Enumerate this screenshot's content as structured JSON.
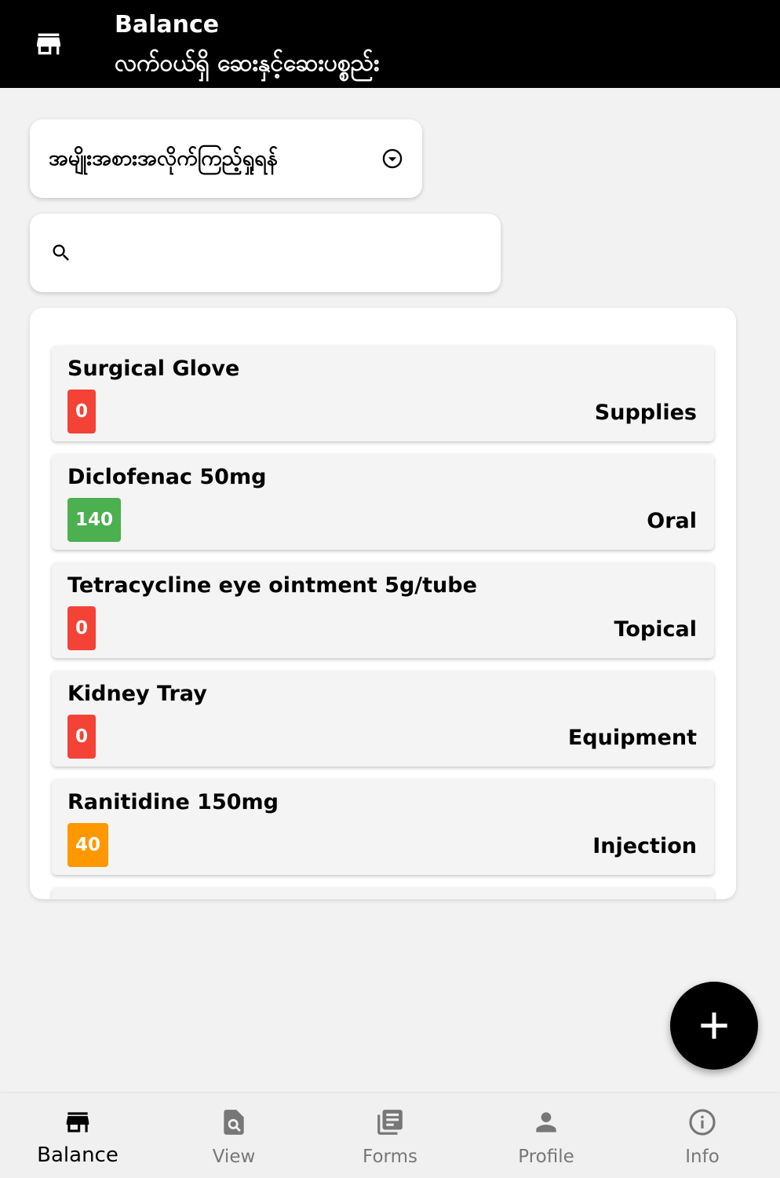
{
  "header": {
    "title": "Balance",
    "subtitle": "လက်ဝယ်ရှိ ဆေးနှင့်ဆေးပစ္စည်း",
    "icon": "store-icon"
  },
  "filter": {
    "label": "အမျိုးအစားအလိုက်ကြည့်ရှုရန်",
    "icon": "chevron-down-circle-icon"
  },
  "search": {
    "value": "",
    "placeholder": "",
    "icon": "search-icon"
  },
  "items": [
    {
      "name": "Surgical Glove",
      "quantity": "0",
      "category": "Supplies",
      "badge_color": "#f44336"
    },
    {
      "name": "Diclofenac 50mg",
      "quantity": "140",
      "category": "Oral",
      "badge_color": "#4caf50"
    },
    {
      "name": "Tetracycline eye ointment 5g/tube",
      "quantity": "0",
      "category": "Topical",
      "badge_color": "#f44336"
    },
    {
      "name": "Kidney Tray",
      "quantity": "0",
      "category": "Equipment",
      "badge_color": "#f44336"
    },
    {
      "name": "Ranitidine 150mg",
      "quantity": "40",
      "category": "Injection",
      "badge_color": "#ff9800"
    }
  ],
  "fab": {
    "icon": "plus-icon"
  },
  "nav": [
    {
      "label": "Balance",
      "icon": "store-icon",
      "active": true
    },
    {
      "label": "View",
      "icon": "search-document-icon",
      "active": false
    },
    {
      "label": "Forms",
      "icon": "library-books-icon",
      "active": false
    },
    {
      "label": "Profile",
      "icon": "person-icon",
      "active": false
    },
    {
      "label": "Info",
      "icon": "info-icon",
      "active": false
    }
  ],
  "colors": {
    "header_bg": "#000000",
    "badge_zero": "#f44336",
    "badge_ok": "#4caf50",
    "badge_low": "#ff9800",
    "nav_active": "#000000",
    "nav_inactive": "#777777"
  }
}
